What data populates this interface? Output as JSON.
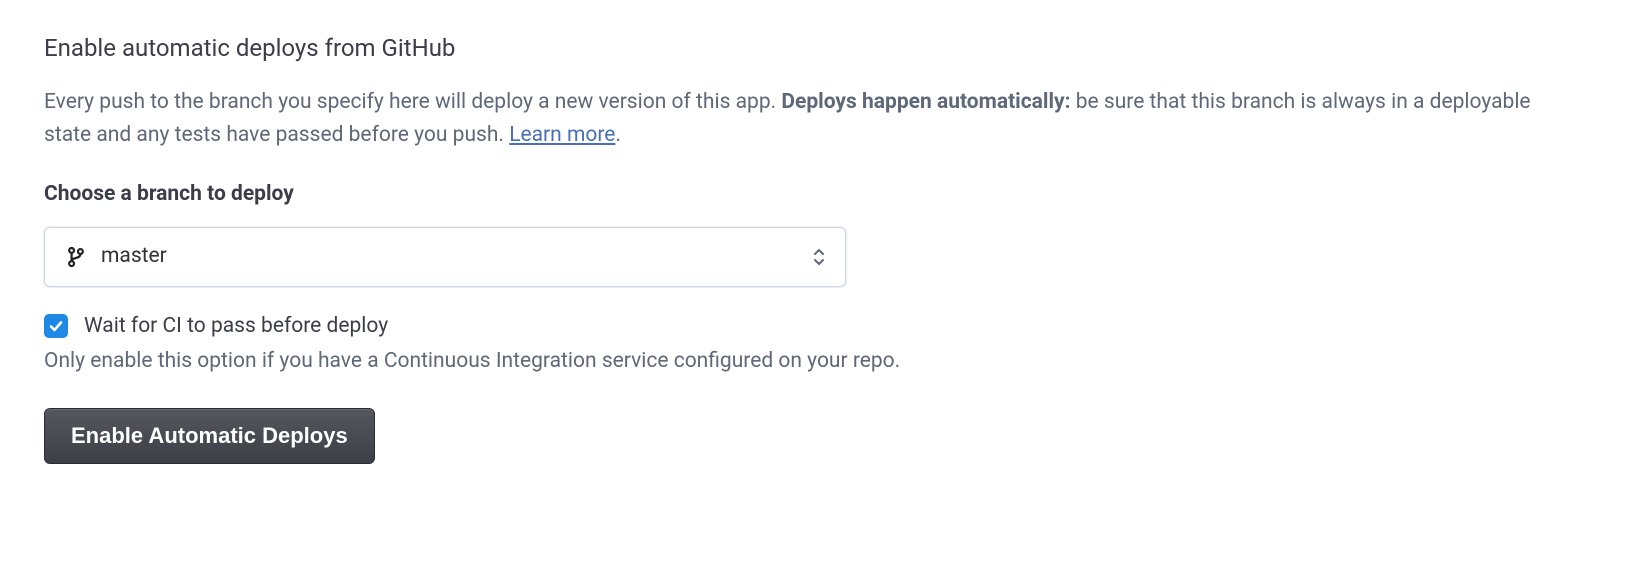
{
  "heading": "Enable automatic deploys from GitHub",
  "description": {
    "pre": "Every push to the branch you specify here will deploy a new version of this app. ",
    "bold": "Deploys happen automatically:",
    "post": " be sure that this branch is always in a deployable state and any tests have passed before you push. ",
    "link": "Learn more",
    "tail": "."
  },
  "branch": {
    "field_label": "Choose a branch to deploy",
    "selected": "master"
  },
  "ci": {
    "checked": true,
    "label": "Wait for CI to pass before deploy",
    "helper": "Only enable this option if you have a Continuous Integration service configured on your repo."
  },
  "action": {
    "enable_label": "Enable Automatic Deploys"
  }
}
